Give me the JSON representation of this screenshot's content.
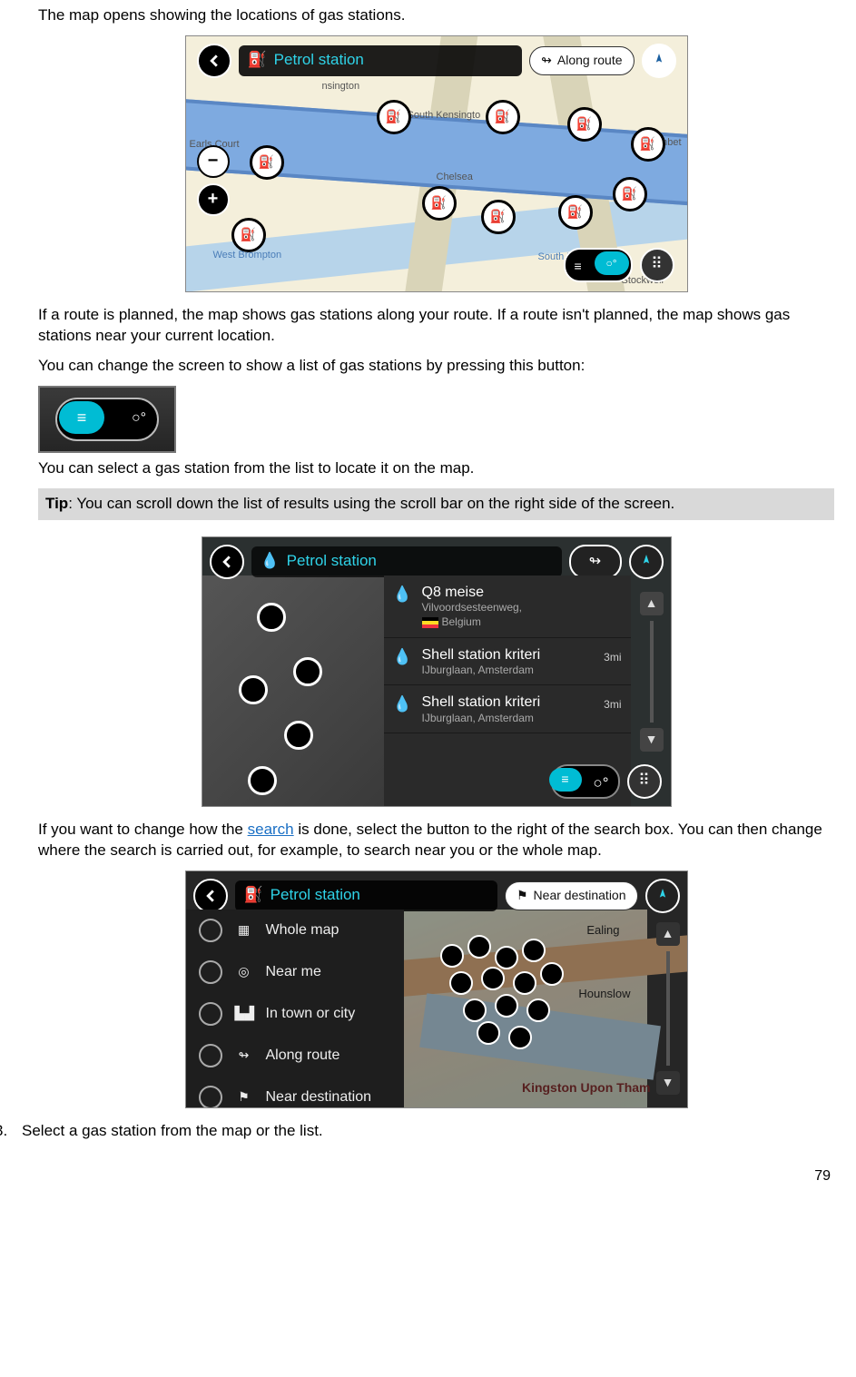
{
  "intro": {
    "p1": "The map opens showing the locations of gas stations.",
    "p2": "If a route is planned, the map shows gas stations along your route. If a route isn't planned, the map shows gas stations near your current location.",
    "p3": "You can change the screen to show a list of gas stations by pressing this button:",
    "p4": "You can select a gas station from the list to locate it on the map."
  },
  "tip": {
    "label": "Tip",
    "text": ": You can scroll down the list of results using the scroll bar on the right side of the screen."
  },
  "search_para": {
    "before": "If you want to change how the ",
    "link": "search",
    "after": " is done, select the button to the right of the search box. You can then change where the search is carried out, for example, to search near you or the whole map."
  },
  "step3": {
    "num": "3.",
    "text": "Select a gas station from the map or the list."
  },
  "page_number": "79",
  "scr1": {
    "search_text": "Petrol station",
    "filter_pill": "Along route",
    "places": {
      "kens": "nsington",
      "south_kens": "South Kensingto",
      "earls": "Earls Court",
      "chelsea": "Chelsea",
      "wbrom": "West Brompton",
      "slam": "South Lambeth",
      "stock": "Stockwell",
      "ombet": "ombet"
    }
  },
  "scr2": {
    "search_text": "Petrol station",
    "items": [
      {
        "name": "Q8 meise",
        "addr1": "Vilvoordsesteenweg,",
        "addr2": "Belgium",
        "dist": "",
        "flag": true
      },
      {
        "name": "Shell station kriteri",
        "addr1": "IJburglaan, Amsterdam",
        "addr2": "",
        "dist": "3mi",
        "flag": false
      },
      {
        "name": "Shell station kriteri",
        "addr1": "IJburglaan, Amsterdam",
        "addr2": "",
        "dist": "3mi",
        "flag": false
      }
    ]
  },
  "scr3": {
    "search_text": "Petrol station",
    "filter_pill": "Near destination",
    "options": [
      {
        "label": "Whole map"
      },
      {
        "label": "Near me"
      },
      {
        "label": "In town or city"
      },
      {
        "label": "Along route"
      },
      {
        "label": "Near destination"
      }
    ],
    "places": {
      "ealing": "Ealing",
      "hounslow": "Hounslow",
      "kingston": "Kingston Upon Tham"
    }
  }
}
